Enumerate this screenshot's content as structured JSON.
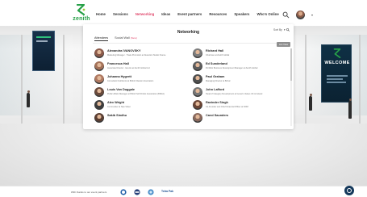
{
  "brand": {
    "name": "zenith",
    "color": "#27a048"
  },
  "nav": {
    "items": [
      {
        "label": "Home",
        "active": false
      },
      {
        "label": "Sessions",
        "active": false
      },
      {
        "label": "Networking",
        "active": true
      },
      {
        "label": "Ideas",
        "active": false
      },
      {
        "label": "Event partners",
        "active": false
      },
      {
        "label": "Resources",
        "active": false
      },
      {
        "label": "Speakers",
        "active": false
      },
      {
        "label": "Who's Online",
        "active": false
      }
    ],
    "active_color": "#e0466b"
  },
  "header": {
    "search_icon": "search-icon",
    "avatar_icon": "user-avatar",
    "menu_icon": "chevron-down-icon"
  },
  "scene": {
    "banner_right": {
      "welcome": "WELCOME"
    }
  },
  "modal": {
    "title": "Networking",
    "sort_label": "Sort By",
    "tabs": [
      {
        "label": "Attendees",
        "badge": "",
        "active": true
      },
      {
        "label": "Social Wall",
        "badge": "(New)",
        "active": false
      }
    ],
    "list_button": "List View",
    "attendees": [
      {
        "name": "Alexandra IVANOVSKY",
        "role": "Marketing Manager · Trade Promotion at Detection Studio France",
        "color": "#8b5a4a"
      },
      {
        "name": "Richard Hall",
        "role": "Chairman at Zenith Global",
        "color": "#7d7d7d"
      },
      {
        "name": "Francesca Hall",
        "role": "Associate Director · Events at Zenith Global Ltd",
        "color": "#a37158"
      },
      {
        "name": "Ed Sunderland",
        "role": "Portfolio Business Development Manager at Zenith Global",
        "color": "#5e5e5e"
      },
      {
        "name": "Johanna Hygrett",
        "role": "Consultant Nutritionist at British Dietetic Association",
        "color": "#b07a62"
      },
      {
        "name": "Paul Graham",
        "role": "Managing Director at Britvic",
        "color": "#4f4f4f"
      },
      {
        "name": "Louis Van Duggale",
        "role": "Public Affairs Manager at British Soft Drinks Association (BSDA)",
        "color": "#6a4a3c"
      },
      {
        "name": "John Lafford",
        "role": "Head of Category Development at Generic Values UK & Ireland",
        "color": "#777777"
      },
      {
        "name": "Alex Wright",
        "role": "Co-Founder at Sips Video",
        "color": "#3d3d3d"
      },
      {
        "name": "Ravinder Singh",
        "role": "Co-Founder and Chief Financial Officer at NOM",
        "color": "#6b4535"
      },
      {
        "name": "Sakib Sindhu",
        "role": "",
        "color": "#5a3e32"
      },
      {
        "name": "Carol Saunders",
        "role": "",
        "color": "#8a6a5e"
      }
    ]
  },
  "footer": {
    "label": "With thanks to our event partners",
    "sponsors": [
      "sponsor-logo-1",
      "sponsor-logo-2",
      "sponsor-logo-3",
      "Tetra Pak"
    ]
  },
  "chat": {
    "icon": "chat-icon",
    "color": "#15395b"
  }
}
